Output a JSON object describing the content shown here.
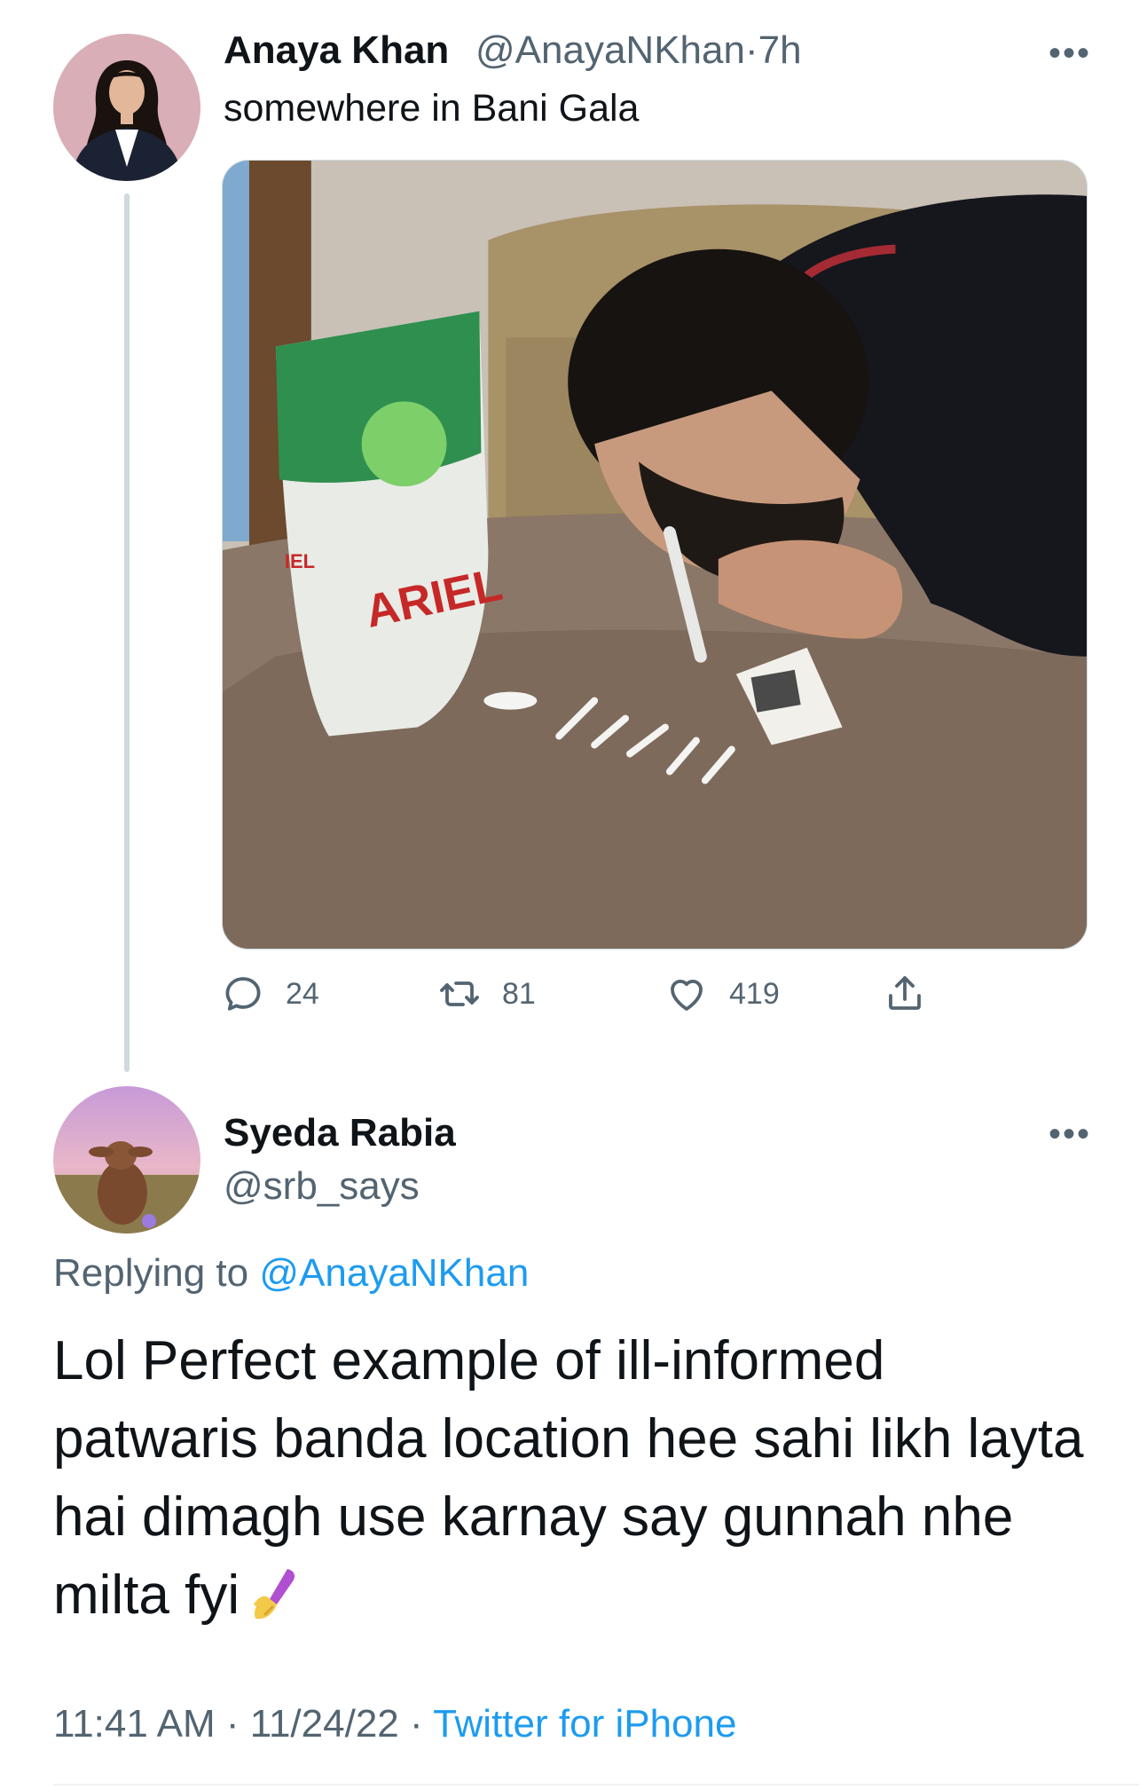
{
  "tweet1": {
    "name": "Anaya Khan",
    "handle": "@AnayaNKhan",
    "separator": "·",
    "time": "7h",
    "text": "somewhere in Bani Gala",
    "more_label": "•••",
    "media_alt": "Man bent over a table next to an Ariel detergent bag with white lines of powder",
    "media_text": {
      "brand": "ARIEL",
      "brand_partial": "IEL"
    },
    "stats": {
      "replies": "24",
      "retweets": "81",
      "likes": "419"
    }
  },
  "tweet2": {
    "name": "Syeda Rabia",
    "handle": "@srb_says",
    "more_label": "•••",
    "replying_prefix": "Replying to ",
    "replying_handle": "@AnayaNKhan",
    "text": "Lol Perfect example of ill-informed patwaris banda location hee sahi likh layta hai dimagh use karnay say gunnah nhe milta fyi",
    "emoji_name": "nail-polish-emoji",
    "meta": {
      "time": "11:41 AM",
      "sep1": " · ",
      "date": "11/24/22",
      "sep2": " · ",
      "source": "Twitter for iPhone"
    }
  },
  "colors": {
    "primary_text": "#0f1419",
    "secondary_text": "#536471",
    "link": "#1d9bf0",
    "thread_line": "#cfd9de"
  }
}
